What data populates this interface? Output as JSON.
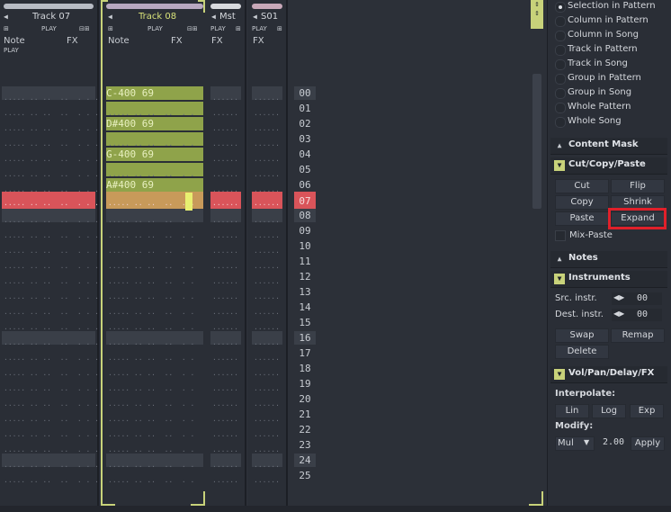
{
  "tracks": [
    {
      "name": "Track 07",
      "play": "PLAY",
      "note": "Note",
      "fx": "FX",
      "play2": "PLAY"
    },
    {
      "name": "Track 08",
      "play": "PLAY",
      "note": "Note",
      "fx": "FX"
    },
    {
      "name": "Mst",
      "play": "PLAY",
      "fx": "FX"
    },
    {
      "name": "S01",
      "play": "PLAY",
      "fx": "FX"
    }
  ],
  "notes": [
    "C-400 69",
    "D#400 69",
    "G-400 69",
    "A#400 69"
  ],
  "line_numbers": [
    "00",
    "01",
    "02",
    "03",
    "04",
    "05",
    "06",
    "07",
    "08",
    "09",
    "10",
    "11",
    "12",
    "13",
    "14",
    "15",
    "16",
    "17",
    "18",
    "19",
    "20",
    "21",
    "22",
    "23",
    "24",
    "25"
  ],
  "scope": {
    "items": [
      "Selection in Pattern",
      "Column in Pattern",
      "Column in Song",
      "Track in Pattern",
      "Track in Song",
      "Group in Pattern",
      "Group in Song",
      "Whole Pattern",
      "Whole Song"
    ],
    "selected": 0
  },
  "sections": {
    "content_mask": "Content Mask",
    "cut_copy_paste": "Cut/Copy/Paste",
    "notes": "Notes",
    "instruments": "Instruments",
    "vol_pan": "Vol/Pan/Delay/FX"
  },
  "ccp": {
    "cut": "Cut",
    "flip": "Flip",
    "copy": "Copy",
    "shrink": "Shrink",
    "paste": "Paste",
    "expand": "Expand",
    "mix_paste": "Mix-Paste"
  },
  "instruments": {
    "src_label": "Src. instr.",
    "src_value": "00",
    "dest_label": "Dest. instr.",
    "dest_value": "00",
    "swap": "Swap",
    "remap": "Remap",
    "delete": "Delete"
  },
  "vol": {
    "interpolate": "Interpolate:",
    "lin": "Lin",
    "log": "Log",
    "exp": "Exp",
    "modify": "Modify:",
    "op": "Mul",
    "value": "2.00",
    "apply": "Apply"
  },
  "colors": {
    "accent": "#c8d27a",
    "highlight_row": "#d9545a",
    "selection": "#8fa34a",
    "expand_outline": "#e0202a"
  }
}
